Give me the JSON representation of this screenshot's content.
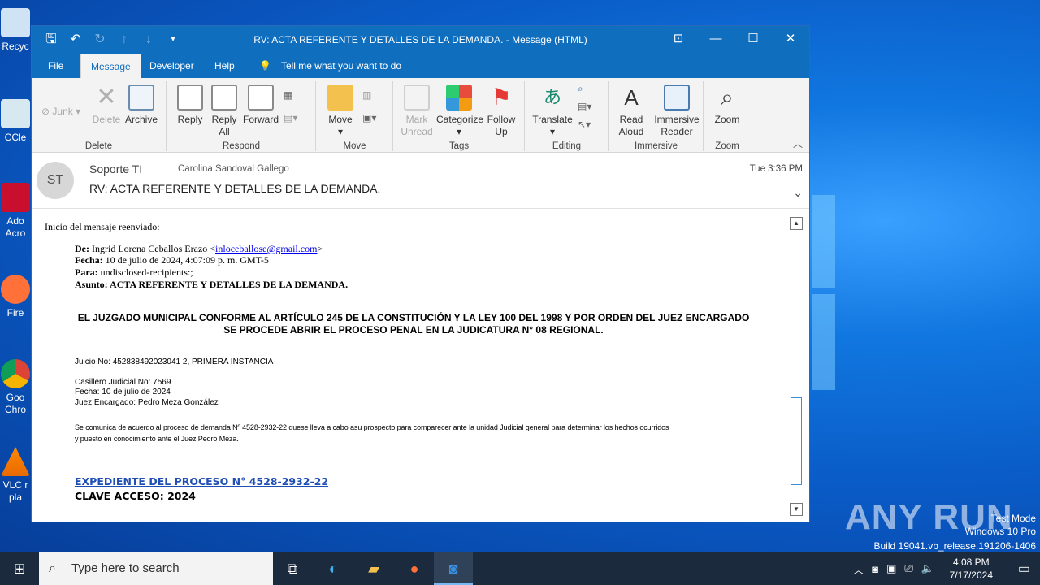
{
  "desktop": {
    "icons": [
      {
        "label": "Recyc"
      },
      {
        "label": "CCle"
      },
      {
        "label": "Ado Acro"
      },
      {
        "label": "Fire"
      },
      {
        "label": "Goo Chro"
      },
      {
        "label": "VLC r pla"
      }
    ],
    "watermark": "ANY RUN",
    "test_mode": [
      "Test Mode",
      "Windows 10 Pro",
      "Build 19041.vb_release.191206-1406"
    ]
  },
  "window": {
    "title": "RV: ACTA REFERENTE Y DETALLES DE LA DEMANDA.  -  Message (HTML)",
    "controls": {
      "ribbon_display": "⊡",
      "minimize": "—",
      "maximize": "☐",
      "close": "✕"
    }
  },
  "tabs": {
    "items": [
      "File",
      "Message",
      "Developer",
      "Help"
    ],
    "tell_me": "Tell me what you want to do"
  },
  "ribbon": {
    "delete": {
      "label": "Delete",
      "junk": "Junk",
      "delete_btn": "Delete",
      "archive": "Archive"
    },
    "respond": {
      "label": "Respond",
      "reply": "Reply",
      "reply_all": "Reply All",
      "forward": "Forward"
    },
    "move": {
      "label": "Move",
      "move_btn": "Move"
    },
    "tags": {
      "label": "Tags",
      "mark_unread": "Mark Unread",
      "categorize": "Categorize",
      "follow_up": "Follow Up"
    },
    "editing": {
      "label": "Editing",
      "translate": "Translate"
    },
    "immersive": {
      "label": "Immersive",
      "read_aloud": "Read Aloud",
      "immersive_reader": "Immersive Reader"
    },
    "zoom": {
      "label": "Zoom",
      "zoom_btn": "Zoom"
    }
  },
  "message": {
    "avatar": "ST",
    "from": "Soporte TI",
    "to": "Carolina Sandoval Gallego",
    "time": "Tue 3:36 PM",
    "subject": "RV: ACTA REFERENTE Y DETALLES DE LA DEMANDA."
  },
  "body": {
    "intro": "Inicio del mensaje reenviado:",
    "de_label": "De:",
    "de_name": " Ingrid Lorena Ceballos Erazo <",
    "de_email": "inloceballose@gmail.com",
    "de_end": ">",
    "fecha_label": "Fecha:",
    "fecha_value": " 10 de julio de 2024, 4:07:09 p. m. GMT-5",
    "para_label": "Para:",
    "para_value": " undisclosed-recipients:;",
    "asunto_label": "Asunto:",
    "asunto_value": " ACTA REFERENTE Y DETALLES DE LA DEMANDA.",
    "heading_line1": "EL JUZGADO MUNICIPAL CONFORME AL ARTÍCULO 245 DE LA CONSTITUCIÓN Y LA LEY 100 DEL 1998 Y POR ORDEN DEL JUEZ ENCARGADO",
    "heading_line2": "SE PROCEDE ABRIR EL PROCESO PENAL EN LA JUDICATURA N° 08 REGIONAL.",
    "juicio": "Juicio No: 452838492023041 2, PRIMERA INSTANCIA",
    "casillero": "Casillero Judicial No: 7569",
    "fecha2": "Fecha: 10 de julio de 2024",
    "juez": "Juez Encargado: Pedro Meza González",
    "comunica_1": "Se comunica de acuerdo al proceso de demanda Nº 4528-2932-22 quese lleva a cabo asu prospecto para comparecer ante la unidad Judicial general para determinar los hechos ocurridos",
    "comunica_2": "y puesto en conocimiento ante el Juez Pedro Meza.",
    "expediente_link": "EXPEDIENTE DEL PROCESO N° 4528-2932-22",
    "clave": "CLAVE ACCESO: 2024"
  },
  "taskbar": {
    "search_placeholder": "Type here to search",
    "time": "4:08 PM",
    "date": "7/17/2024"
  }
}
